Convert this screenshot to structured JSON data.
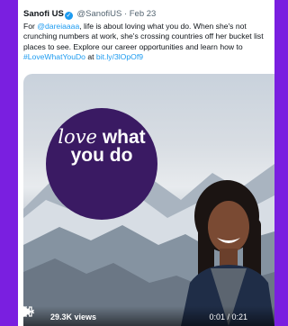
{
  "tweet": {
    "author_name": "Sanofi US",
    "handle": "@SanofiUS",
    "separator": "·",
    "date": "Feb 23",
    "body": {
      "part1": "For ",
      "mention": "@dareiaaaa",
      "part2": ", life is about loving what you do. When she's not crunching numbers at work, she's crossing countries off her bucket list places to see. Explore our career opportunities and learn how to ",
      "hashtag": "#LoveWhatYouDo",
      "part3": " at ",
      "link": "bit.ly/3lOpOf9"
    }
  },
  "video": {
    "overlay_line1": "love what",
    "overlay_line1_script": "love",
    "overlay_line1_rest": " what",
    "overlay_line2": "you do",
    "views": "29.3K views",
    "time": "0:01 / 0:21",
    "progress_fraction": 0.05
  },
  "colors": {
    "page_background": "#7a1fe0",
    "link_blue": "#1d9bf0",
    "promo_circle": "#3a1a63"
  },
  "icons": [
    "verified-badge-icon",
    "play-icon",
    "volume-icon",
    "fullscreen-icon"
  ]
}
